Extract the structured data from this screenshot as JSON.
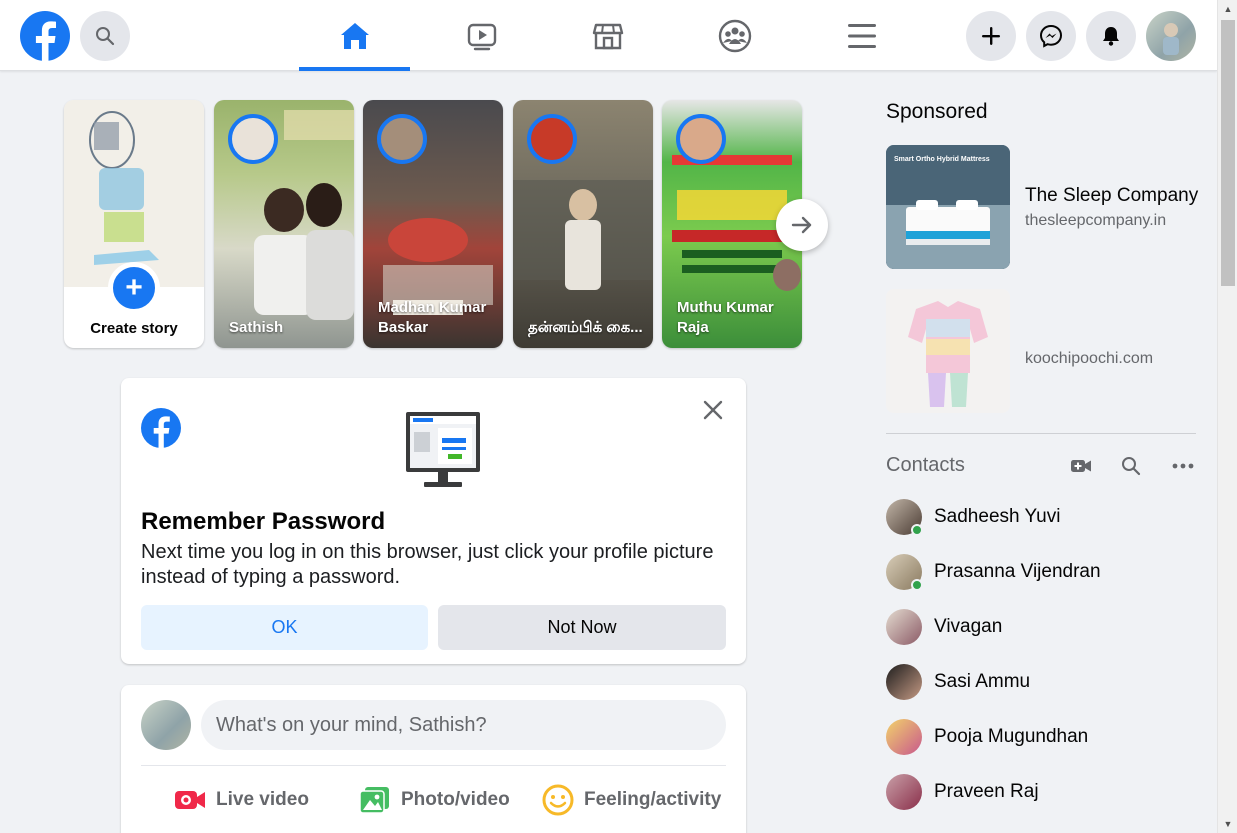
{
  "nav": {
    "tabs": [
      "home",
      "watch",
      "marketplace",
      "groups",
      "menu"
    ],
    "active_tab": "home",
    "accent": "#1877f2"
  },
  "stories": {
    "create_label": "Create story",
    "items": [
      {
        "name": "Sathish"
      },
      {
        "name": "Madhan Kumar Baskar"
      },
      {
        "name": "தன்னம்பிக் கை..."
      },
      {
        "name": "Muthu Kumar Raja"
      }
    ]
  },
  "remember": {
    "title": "Remember Password",
    "body": "Next time you log in on this browser, just click your profile picture instead of typing a password.",
    "ok_label": "OK",
    "not_now_label": "Not Now"
  },
  "composer": {
    "placeholder": "What's on your mind, Sathish?",
    "live_label": "Live video",
    "photo_label": "Photo/video",
    "feeling_label": "Feeling/activity"
  },
  "sponsored": {
    "heading": "Sponsored",
    "ads": [
      {
        "title": "The Sleep Company",
        "url": "thesleepcompany.in",
        "image_text": "Smart Ortho Hybrid Mattress"
      },
      {
        "title": "",
        "url": "koochipoochi.com"
      }
    ]
  },
  "contacts": {
    "heading": "Contacts",
    "items": [
      {
        "name": "Sadheesh Yuvi",
        "online": true
      },
      {
        "name": "Prasanna Vijendran",
        "online": true
      },
      {
        "name": "Vivagan",
        "online": false
      },
      {
        "name": "Sasi Ammu",
        "online": false
      },
      {
        "name": "Pooja Mugundhan",
        "online": false
      },
      {
        "name": "Praveen Raj",
        "online": false
      }
    ]
  }
}
